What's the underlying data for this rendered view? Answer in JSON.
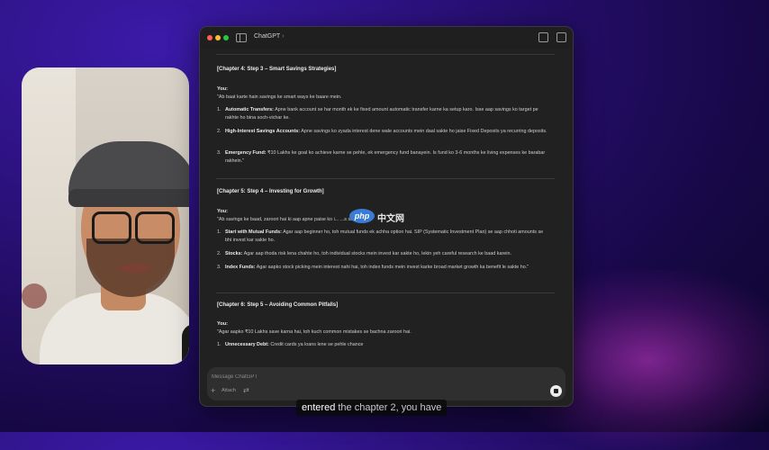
{
  "window": {
    "title": "ChatGPT",
    "title_chevron": "›"
  },
  "chat": {
    "sections": [
      {
        "heading": "[Chapter 4: Step 3 – Smart Savings Strategies]",
        "speaker": "You:",
        "quote": "\"Ab baat karte hain savings ke smart ways ke baare mein.",
        "items": [
          {
            "n": "1.",
            "title": "Automatic Transfers:",
            "text": " Apne bank account se har month ek ke fixed amount automatic transfer karne ka setup karo. Isse aap savings ko target pe rakhte ho bina soch-vichar ke."
          },
          {
            "n": "2.",
            "title": "High-Interest Savings Accounts:",
            "text": " Apne savings ko zyada interest dene wale accounts mein daal sakte ho jaise Fixed Deposits ya recurring deposits."
          },
          {
            "n": "3.",
            "title": "Emergency Fund:",
            "text": " ₹10 Lakhs ke goal ko achieve karne se pehle, ek emergency fund banayein. Is fund ko 3-6 months ke living expenses ke barabar rakhein.\""
          }
        ]
      },
      {
        "heading": "[Chapter 5: Step 4 – Investing for Growth]",
        "speaker": "You:",
        "quote": "\"Ab savings ke baad, zaroori hai ki aap apne paise ko i... ...s sabe.",
        "items": [
          {
            "n": "1.",
            "title": "Start with Mutual Funds:",
            "text": " Agar aap beginner ho, toh mutual funds ek achha option hai. SIP (Systematic Investment Plan) se aap chhoti amounts se bhi invest kar sakte ho."
          },
          {
            "n": "2.",
            "title": "Stocks:",
            "text": " Agar aap thoda risk lena chahte ho, toh individual stocks mein invest kar sakte ho, lekin yeh careful research ke baad karein."
          },
          {
            "n": "3.",
            "title": "Index Funds:",
            "text": " Agar aapko stock picking mein interest nahi hai, toh index funds mein invest karke broad market growth ka benefit le sakte ho.\""
          }
        ]
      },
      {
        "heading": "[Chapter 6: Step 5 – Avoiding Common Pitfalls]",
        "speaker": "You:",
        "quote": "\"Agar aapko ₹10 Lakhs save karna hai, toh kuch common mistakes se bachna zaroori hai.",
        "items": [
          {
            "n": "1.",
            "title": "Unnecessary Debt:",
            "text": " Credit cards ya loans lene se pehle chance"
          }
        ]
      }
    ]
  },
  "composer": {
    "placeholder": "Message ChatGPT",
    "plus": "+",
    "attach_label": "Attach",
    "tools_glyph": "⇄"
  },
  "overlays": {
    "php_badge": "php",
    "php_text": "中文网",
    "caption_highlight": "entered",
    "caption_rest": " the chapter 2, you have"
  }
}
